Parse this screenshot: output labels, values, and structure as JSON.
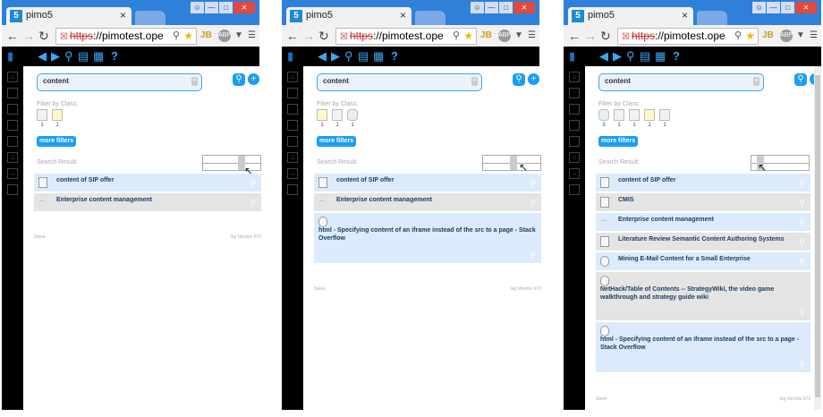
{
  "windows": [
    {
      "tab_title": "pimo5",
      "url_scheme": "https",
      "url_rest": "://pimotest.ope",
      "search_value": "content",
      "filter_label": "Filter by Class:",
      "class_counts": [
        "1",
        "1"
      ],
      "more_filters": "more filters",
      "search_result_label": "Search Result:",
      "results": [
        {
          "title": "content of SIP offer",
          "color": "blue"
        },
        {
          "title": "Enterprise content management",
          "color": "gray"
        }
      ],
      "footer_left": "Sieve",
      "footer_right": "log   Version 673"
    },
    {
      "tab_title": "pimo5",
      "url_scheme": "https",
      "url_rest": "://pimotest.ope",
      "search_value": "content",
      "filter_label": "Filter by Class:",
      "class_counts": [
        "1",
        "1",
        "1"
      ],
      "more_filters": "more filters",
      "search_result_label": "Search Result:",
      "results": [
        {
          "title": "content of SIP offer",
          "color": "blue"
        },
        {
          "title": "Enterprise content management",
          "color": "gray"
        },
        {
          "title": "html - Specifying content of an iframe instead of the src to a page - Stack Overflow",
          "color": "blue"
        }
      ],
      "footer_left": "Sieve",
      "footer_right": "log   Version 673"
    },
    {
      "tab_title": "pimo5",
      "url_scheme": "https",
      "url_rest": "://pimotest.ope",
      "search_value": "content",
      "filter_label": "Filter by Class:",
      "class_counts": [
        "3",
        "1",
        "1",
        "1",
        "1"
      ],
      "more_filters": "more filters",
      "search_result_label": "Search Result:",
      "results": [
        {
          "title": "content of SIP offer",
          "color": "blue"
        },
        {
          "title": "CMIS",
          "color": "gray"
        },
        {
          "title": "Enterprise content management",
          "color": "blue"
        },
        {
          "title": "Literature Review Semantic Content Authoring Systems",
          "color": "gray"
        },
        {
          "title": "Mining E-Mail Content for a Small Enterprise",
          "color": "blue"
        },
        {
          "title": "NetHack/Table of Contents -- StrategyWiki, the video game walkthrough and strategy guide wiki",
          "color": "gray"
        },
        {
          "title": "html - Specifying content of an iframe instead of the src to a page - Stack Overflow",
          "color": "blue"
        }
      ],
      "footer_left": "Sieve",
      "footer_right": "log   Version 673"
    }
  ]
}
